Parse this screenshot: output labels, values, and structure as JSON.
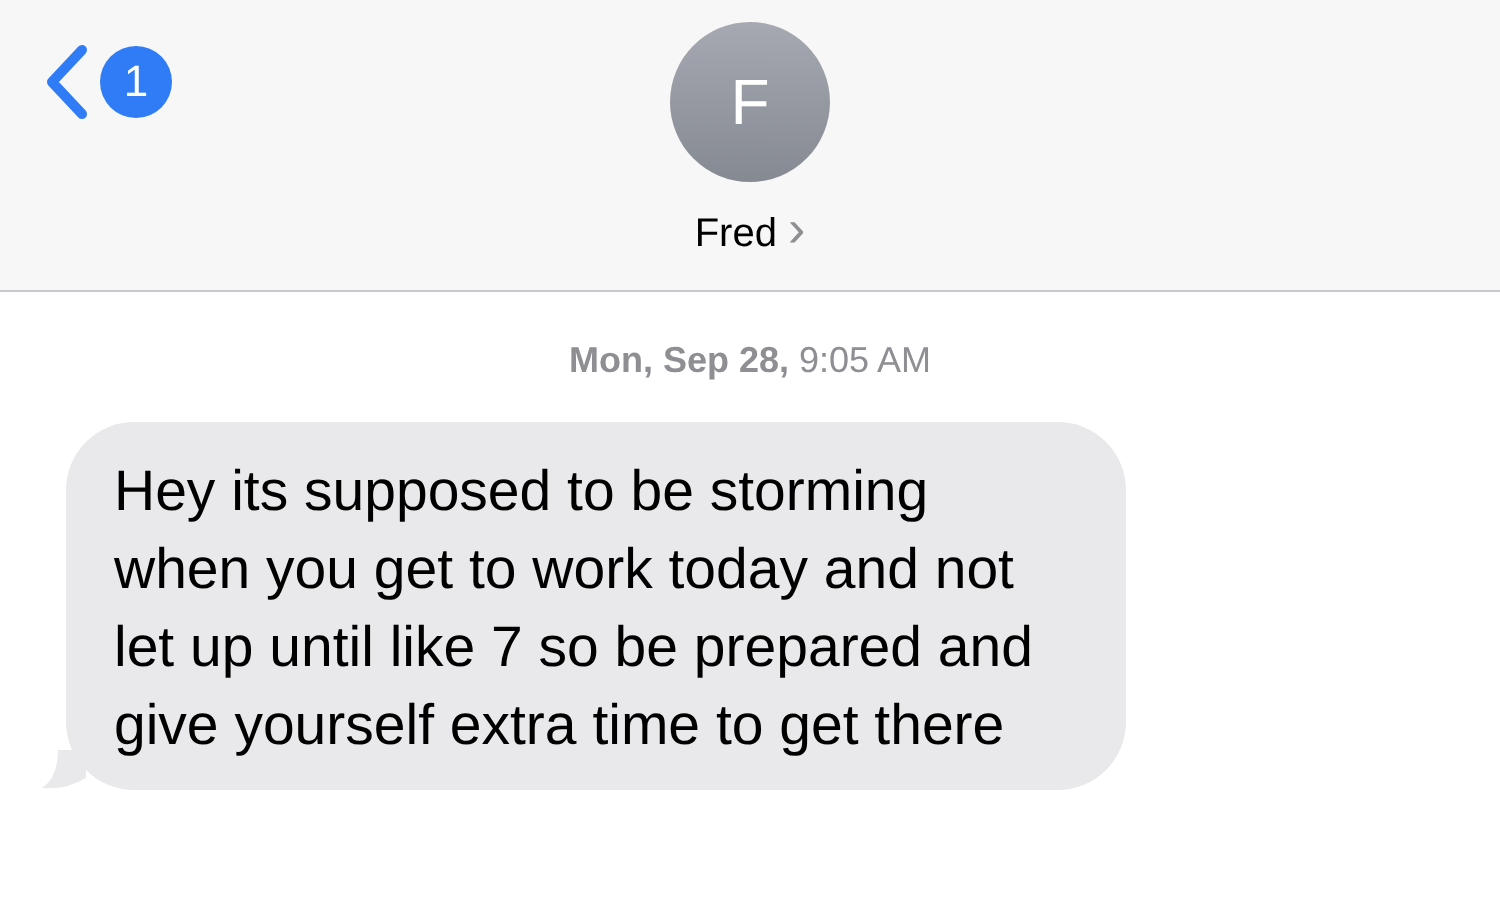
{
  "header": {
    "unread_count": "1",
    "avatar_letter": "F",
    "contact_name": "Fred",
    "contact_chevron": "›"
  },
  "timestamp": "**Mon, Sep 28,** 9:05 AM",
  "messages": [
    {
      "kind": "received",
      "text": "Hey its supposed to be storming when you get to work today and not let up until like 7 so be prepared and give yourself extra time to get there"
    }
  ]
}
